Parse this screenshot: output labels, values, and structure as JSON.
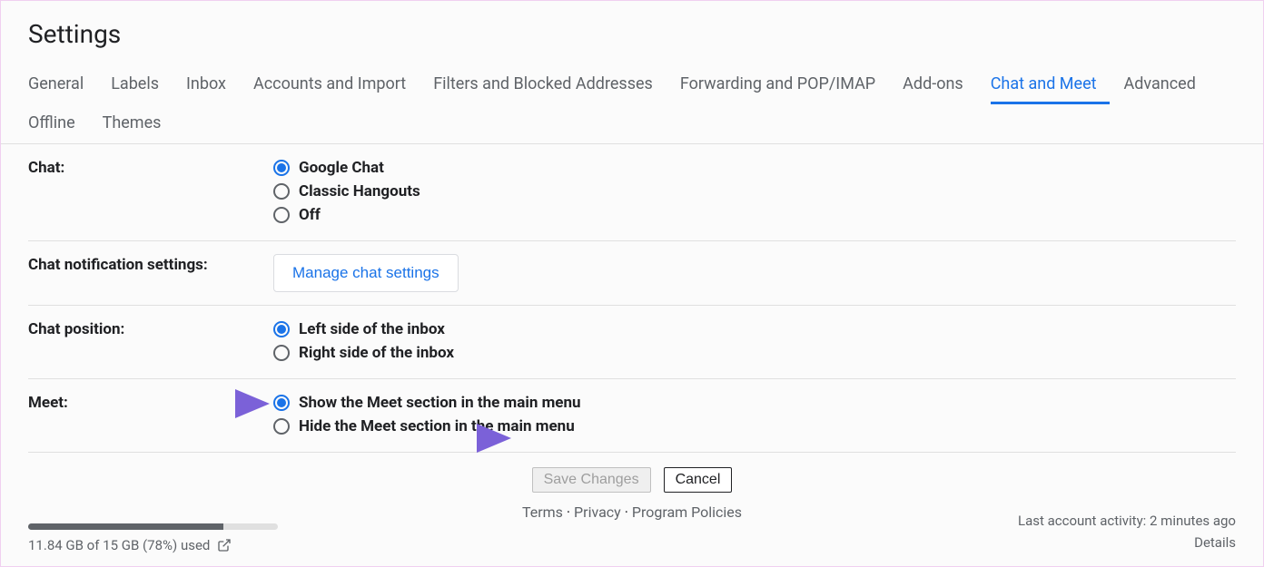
{
  "pageTitle": "Settings",
  "tabs": {
    "general": "General",
    "labels": "Labels",
    "inbox": "Inbox",
    "accounts": "Accounts and Import",
    "filters": "Filters and Blocked Addresses",
    "forwarding": "Forwarding and POP/IMAP",
    "addons": "Add-ons",
    "chatmeet": "Chat and Meet",
    "advanced": "Advanced",
    "offline": "Offline",
    "themes": "Themes"
  },
  "settings": {
    "chat": {
      "label": "Chat:",
      "opt_google": "Google Chat",
      "opt_classic": "Classic Hangouts",
      "opt_off": "Off"
    },
    "notif": {
      "label": "Chat notification settings:",
      "button": "Manage chat settings"
    },
    "position": {
      "label": "Chat position:",
      "opt_left": "Left side of the inbox",
      "opt_right": "Right side of the inbox"
    },
    "meet": {
      "label": "Meet:",
      "opt_show": "Show the Meet section in the main menu",
      "opt_hide": "Hide the Meet section in the main menu"
    }
  },
  "actions": {
    "save": "Save Changes",
    "cancel": "Cancel"
  },
  "footer": {
    "terms": "Terms",
    "privacy": "Privacy",
    "policies": "Program Policies",
    "sep": " · ",
    "storage_text": "11.84 GB of 15 GB (78%) used",
    "storage_percent": 78,
    "activity": "Last account activity: 2 minutes ago",
    "details": "Details"
  }
}
